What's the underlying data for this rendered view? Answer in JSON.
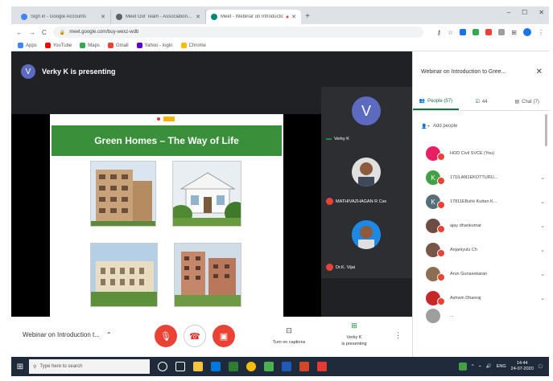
{
  "browser": {
    "tabs": [
      {
        "title": "Sign in - Google Accounts",
        "favicon_color": "#4285f4",
        "active": false
      },
      {
        "title": "Meet Our Team - Association...",
        "favicon_color": "#5f6368",
        "active": false
      },
      {
        "title": "Meet - Webinar on Introductio...",
        "favicon_color": "#00897b",
        "active": true
      }
    ],
    "new_tab_icon": "plus-icon",
    "url": "meet.google.com/buy-wexz-wdb",
    "bookmarks": [
      {
        "label": "Apps",
        "icon_color": "#4285f4"
      },
      {
        "label": "YouTube",
        "icon_color": "#ff0000"
      },
      {
        "label": "Maps",
        "icon_color": "#34a853"
      },
      {
        "label": "Gmail",
        "icon_color": "#ea4335"
      },
      {
        "label": "Yahoo - login",
        "icon_color": "#6001d2"
      },
      {
        "label": "Chrome",
        "icon_color": "#fbbc05"
      }
    ]
  },
  "meet": {
    "presenter_initial": "V",
    "presenting_text": "Verky K is presenting",
    "slide": {
      "title": "Green Homes – The Way of Life",
      "title_bg": "#3a8f3a"
    },
    "tiles": [
      {
        "name": "Verky K",
        "initial": "V",
        "color": "#5c6bc0",
        "muted": false
      },
      {
        "name": "MATHIVAZHAGAN R Cse",
        "initial": "",
        "color": "#8d6e63",
        "muted": true
      },
      {
        "name": "Dr.K. Vijai",
        "initial": "",
        "color": "#1e88e5",
        "muted": true
      }
    ],
    "meeting_title": "Webinar on Introduction t...",
    "controls": {
      "captions_label": "Turn on captions",
      "present_label_1": "Verky K",
      "present_label_2": "is presenting"
    }
  },
  "panel": {
    "title": "Webinar on Introduction to Gree...",
    "tabs": [
      {
        "label": "People (57)",
        "active": true
      },
      {
        "label": "44",
        "active": false
      },
      {
        "label": "Chat (7)",
        "active": false
      }
    ],
    "add_people": "Add people",
    "participants": [
      {
        "name": "HOD Civil SVCE (You)",
        "initial": "",
        "color": "#e91e63"
      },
      {
        "name": "171ILAN1EKOTTURU...",
        "initial": "K",
        "color": "#43a047"
      },
      {
        "name": "17811EBuhk Kuttan K...",
        "initial": "K",
        "color": "#546e7a"
      },
      {
        "name": "ajay dhankumar",
        "initial": "",
        "color": "#6d4c41"
      },
      {
        "name": "Anjaniyulu Ch",
        "initial": "",
        "color": "#795548"
      },
      {
        "name": "Arun Gunasekaran",
        "initial": "",
        "color": "#8e6e53"
      },
      {
        "name": "Ashwin Dhanraj",
        "initial": "",
        "color": "#c62828"
      },
      {
        "name": "...",
        "initial": "",
        "color": "#9e9e9e"
      }
    ]
  },
  "taskbar": {
    "search_placeholder": "Type here to search",
    "time": "14:44",
    "date": "24-07-2020",
    "lang": "ENG"
  }
}
